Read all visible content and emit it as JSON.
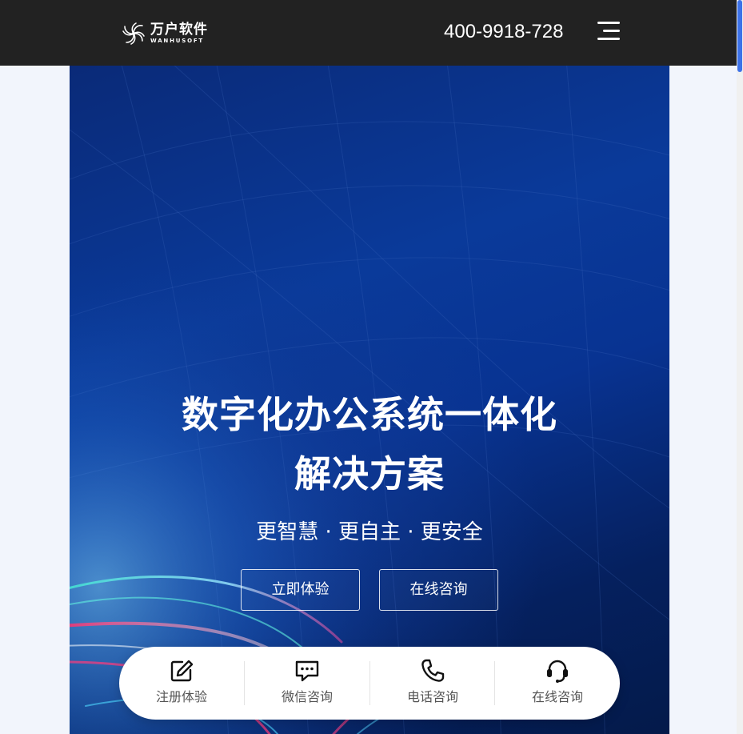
{
  "header": {
    "logo_cn": "万户软件",
    "logo_en": "WANHUSOFT",
    "phone": "400-9918-728",
    "menu_icon": "hamburger-menu-icon"
  },
  "hero": {
    "title_line1": "数字化办公系统一体化",
    "title_line2": "解决方案",
    "subtitle": "更智慧 · 更自主 · 更安全",
    "buttons": [
      {
        "label": "立即体验"
      },
      {
        "label": "在线咨询"
      }
    ]
  },
  "contact_bar": {
    "items": [
      {
        "label": "注册体验",
        "icon": "edit-icon"
      },
      {
        "label": "微信咨询",
        "icon": "chat-bubble-icon"
      },
      {
        "label": "电话咨询",
        "icon": "phone-icon"
      },
      {
        "label": "在线咨询",
        "icon": "headset-icon"
      }
    ]
  },
  "colors": {
    "header_bg": "#222222",
    "page_bg": "#f2f5fc",
    "hero_blue": "#0a3a9a",
    "scroll_accent": "#3d72e8"
  }
}
